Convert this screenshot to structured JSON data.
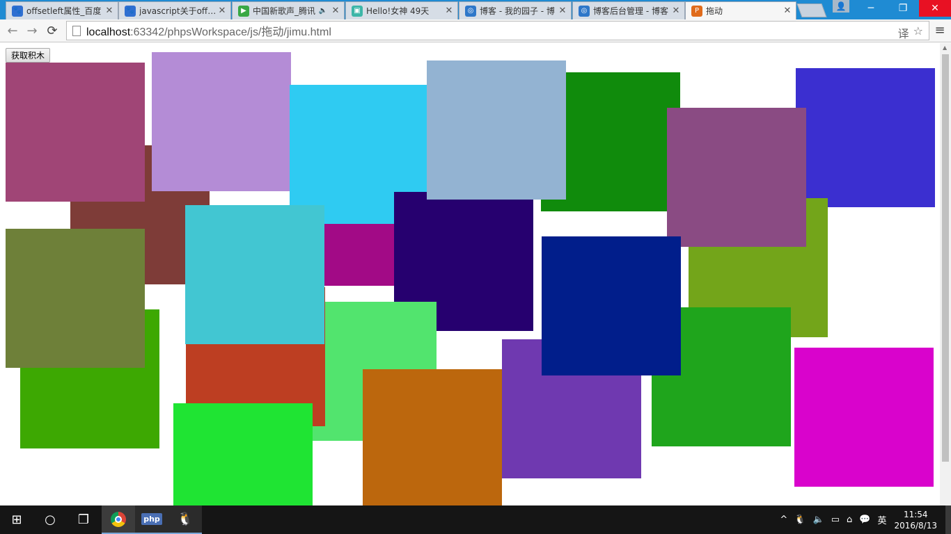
{
  "browser": {
    "tabs": [
      {
        "title": "offsetleft属性_百度",
        "favicon_color": "#2f6fd1",
        "favicon_glyph": "paw-icon"
      },
      {
        "title": "javascript关于offse",
        "favicon_color": "#2f6fd1",
        "favicon_glyph": "paw-icon"
      },
      {
        "title": "中国新歌声_腾讯",
        "favicon_color": "#39a845",
        "favicon_glyph": "play-icon",
        "audio": "🔈"
      },
      {
        "title": "Hello!女神 49天",
        "favicon_color": "#3cb6a8",
        "favicon_glyph": "tv-icon"
      },
      {
        "title": "博客 - 我的园子 - 博",
        "favicon_color": "#2e77c9",
        "favicon_glyph": "blog-icon"
      },
      {
        "title": "博客后台管理 - 博客",
        "favicon_color": "#2e77c9",
        "favicon_glyph": "blog-icon"
      },
      {
        "title": "拖动",
        "favicon_color": "#e06b1b",
        "favicon_glyph": "php-icon",
        "active": true
      }
    ],
    "close_glyph": "✕",
    "window_controls": {
      "minimize": "─",
      "maximize": "❐",
      "close": "✕"
    },
    "profile_glyph": "👤",
    "nav": {
      "back": "←",
      "forward": "→",
      "reload": "⟳"
    },
    "url": {
      "host": "localhost",
      "path": ":63342/phpsWorkspace/js/拖动/jimu.html"
    },
    "omnibox_icons": {
      "translate": "译",
      "star": "☆"
    },
    "menu_glyph": "≡"
  },
  "page": {
    "button_label": "获取积木",
    "blocks": [
      {
        "color": "#7e3c38"
      },
      {
        "color": "#a04576"
      },
      {
        "color": "#b48cd6"
      },
      {
        "color": "#a20a86"
      },
      {
        "color": "#2fcbf2"
      },
      {
        "color": "#93b3d2"
      },
      {
        "color": "#108b0c"
      },
      {
        "color": "#3b2fd0"
      },
      {
        "color": "#73a51a"
      },
      {
        "color": "#8a4b83"
      },
      {
        "color": "#26006f"
      },
      {
        "color": "#52e46e"
      },
      {
        "color": "#bd3e22"
      },
      {
        "color": "#42c6d2"
      },
      {
        "color": "#3da802"
      },
      {
        "color": "#6e8039"
      },
      {
        "color": "#1fe433"
      },
      {
        "color": "#bc670d"
      },
      {
        "color": "#6f39b0"
      },
      {
        "color": "#011e8b"
      },
      {
        "color": "#1fa51c"
      },
      {
        "color": "#d903cc"
      }
    ]
  },
  "taskbar": {
    "start_glyph": "⊞",
    "search_glyph": "○",
    "taskview_glyph": "❐",
    "php_label": "php",
    "tray_icons": [
      "^",
      "🐧",
      "🔈",
      "▭",
      "⌂",
      "💬",
      "英"
    ],
    "clock_time": "11:54",
    "clock_date": "2016/8/13"
  }
}
